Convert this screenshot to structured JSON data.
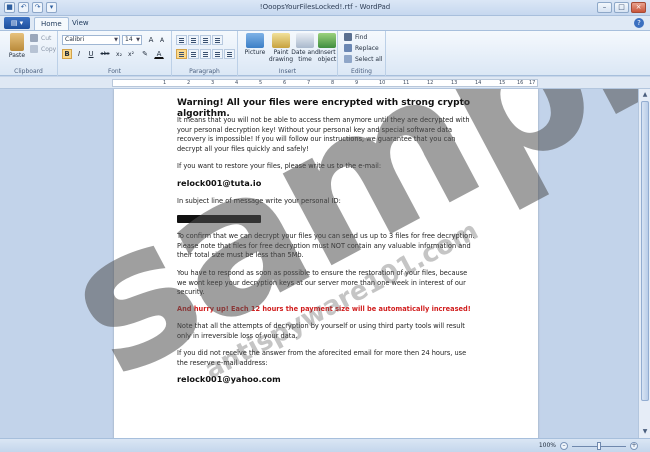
{
  "window": {
    "title": "!OoopsYourFilesLocked!.rtf - WordPad"
  },
  "qat": {
    "icons": [
      "save-icon",
      "undo-icon",
      "redo-icon"
    ]
  },
  "tabs": [
    {
      "label": "Home"
    },
    {
      "label": "View"
    }
  ],
  "ribbon": {
    "clipboard": {
      "label": "Clipboard",
      "paste": "Paste",
      "cut": "Cut",
      "copy": "Copy"
    },
    "font": {
      "label": "Font",
      "family": "Calibri",
      "size": "14",
      "bold": "B",
      "italic": "I",
      "underline": "U",
      "strike": "abc",
      "sub": "x₂",
      "sup": "x²"
    },
    "paragraph": {
      "label": "Paragraph"
    },
    "insert": {
      "label": "Insert",
      "picture": "Picture",
      "paint": "Paint drawing",
      "datetime": "Date and time",
      "object": "Insert object"
    },
    "editing": {
      "label": "Editing",
      "find": "Find",
      "replace": "Replace",
      "select_all": "Select all"
    }
  },
  "ruler": {
    "numbers": [
      "1",
      "2",
      "3",
      "4",
      "5",
      "6",
      "7",
      "8",
      "9",
      "10",
      "11",
      "12",
      "13",
      "14",
      "15",
      "16",
      "17"
    ]
  },
  "document": {
    "heading": "Warning! All your files were encrypted with strong crypto algorithm.",
    "p1": "It means that you will not be able to access them anymore until they are decrypted with your personal decryption key! Without your personal key and special software data recovery is impossible! If you will follow our instructions, we guarantee that you can decrypt all your files quickly and safely!",
    "p2": "If you want to restore your files, please write us to the e-mail:",
    "email1": "relock001@tuta.io",
    "p3": "In subject line of message write your personal ID:",
    "p4": "To confirm that we can decrypt your files you can send us up to 3 files for free decryption. Please note that files for free decryption must NOT contain any valuable information and their total size must be less than 5Mb.",
    "p5": "You have to respond as soon as possible to ensure the restoration of your files, because we wont keep your decryption keys at our server more than one week in interest of our security.",
    "red": "And hurry up! Each 12 hours the payment size will be automatically increased!",
    "p6": "Note that all the attempts of decryption by yourself or using third party tools will result only in irreversible loss of your data.",
    "p7": "If you did not receive the answer from the aforecited email for more then 24 hours, use the reserve e-mail address:",
    "email2": "relock001@yahoo.com"
  },
  "watermark": {
    "main": "sample",
    "site": "antispyware101.com"
  },
  "status": {
    "zoom": "100%"
  }
}
